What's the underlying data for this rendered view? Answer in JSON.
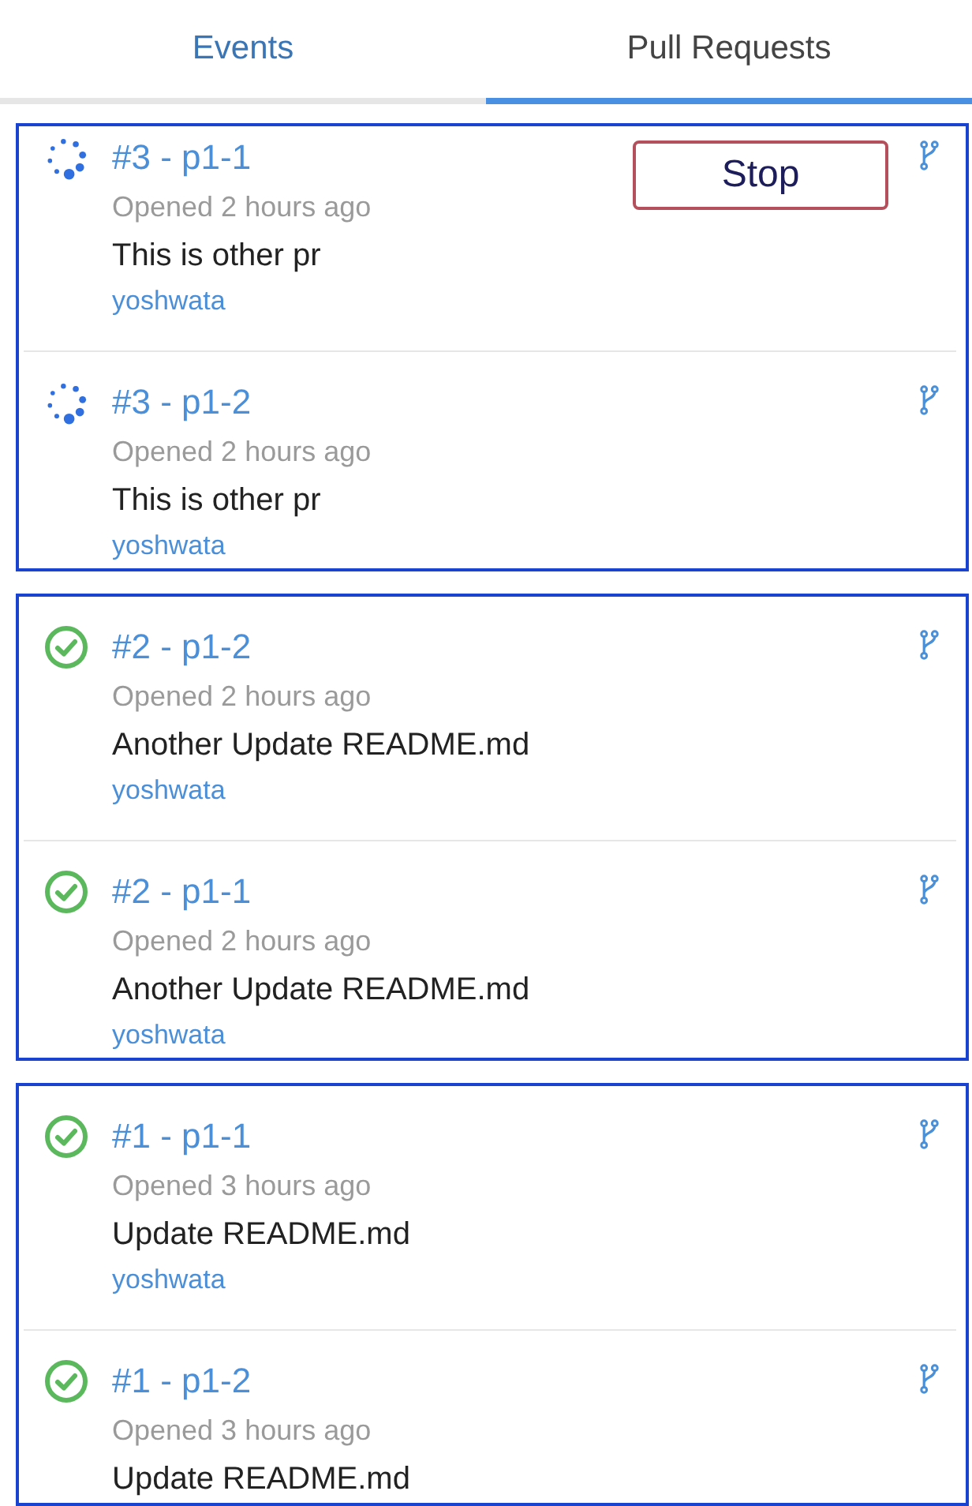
{
  "tabs": [
    {
      "label": "Events",
      "selected": false
    },
    {
      "label": "Pull Requests",
      "selected": true
    }
  ],
  "groups": [
    {
      "items": [
        {
          "kind": "running",
          "title": "#3 - p1-1",
          "opened": "Opened 2 hours ago",
          "description": "This is other pr",
          "author": "yoshwata",
          "stop_button": "Stop"
        },
        {
          "kind": "running",
          "title": "#3 - p1-2",
          "opened": "Opened 2 hours ago",
          "description": "This is other pr",
          "author": "yoshwata"
        }
      ]
    },
    {
      "items": [
        {
          "kind": "success",
          "title": "#2 - p1-2",
          "opened": "Opened 2 hours ago",
          "description": "Another Update README.md",
          "author": "yoshwata"
        },
        {
          "kind": "success",
          "title": "#2 - p1-1",
          "opened": "Opened 2 hours ago",
          "description": "Another Update README.md",
          "author": "yoshwata"
        }
      ]
    },
    {
      "items": [
        {
          "kind": "success",
          "title": "#1 - p1-1",
          "opened": "Opened 3 hours ago",
          "description": "Update README.md",
          "author": "yoshwata"
        },
        {
          "kind": "success",
          "title": "#1 - p1-2",
          "opened": "Opened 3 hours ago",
          "description": "Update README.md"
        }
      ]
    }
  ]
}
